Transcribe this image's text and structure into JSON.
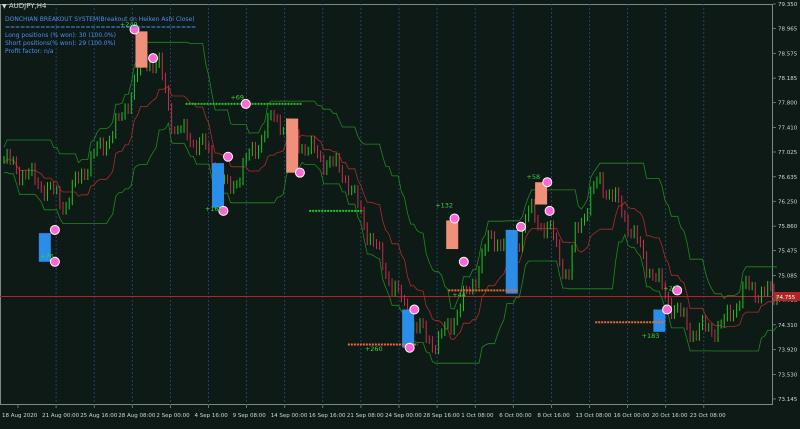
{
  "symbol_tab": "AUDJPY,H4",
  "info_panel": {
    "title": "DONCHIAN BREAKOUT SYSTEM(Breakout on Heiken Ashi Close)",
    "separator": "======================================",
    "long_positions": "Long positions (% won): 30 (100.0%)",
    "short_positions": "Short positions(% won): 29 (100.0%)",
    "profit_factor": "Profit factor: n/a"
  },
  "colors": {
    "background": "#0d1a16",
    "grid": "#2b4a7a",
    "bull_bar": "#21c521",
    "bear_bar": "#c5304a",
    "channel": "#1f8a1f",
    "midline": "#b02a2a",
    "price_line": "#b02424",
    "long_box": "#2a8de8",
    "short_box": "#f0907a",
    "profit_label": "#3fcf3f",
    "signal_marker": "#ff66d6"
  },
  "chart_data": {
    "type": "candlestick",
    "y_axis": {
      "min": 73.05,
      "max": 79.35,
      "ticks": [
        "79.350",
        "78.965",
        "78.575",
        "78.185",
        "77.800",
        "77.410",
        "77.025",
        "76.635",
        "76.250",
        "75.860",
        "75.475",
        "75.085",
        "74.700",
        "74.310",
        "73.920",
        "73.530",
        "73.145"
      ],
      "current_price": "74.755"
    },
    "x_axis": {
      "ticks": [
        "18 Aug 2020",
        "21 Aug 00:00",
        "25 Aug 16:00",
        "28 Aug 08:00",
        "2 Sep 00:00",
        "4 Sep 16:00",
        "9 Sep 08:00",
        "14 Sep 00:00",
        "16 Sep 16:00",
        "21 Sep 08:00",
        "24 Sep 00:00",
        "28 Sep 16:00",
        "1 Oct 08:00",
        "6 Oct 00:00",
        "8 Oct 16:00",
        "13 Oct 08:00",
        "16 Oct 00:00",
        "20 Oct 16:00",
        "23 Oct 08:00"
      ]
    },
    "series": [
      {
        "name": "AUDJPY H4 Heiken Ashi",
        "waypoints": [
          [
            0,
            76.9
          ],
          [
            0.05,
            76.5
          ],
          [
            0.08,
            76.2
          ],
          [
            0.1,
            76.7
          ],
          [
            0.15,
            77.5
          ],
          [
            0.18,
            78.5
          ],
          [
            0.2,
            78.4
          ],
          [
            0.22,
            77.4
          ],
          [
            0.26,
            77.1
          ],
          [
            0.29,
            76.4
          ],
          [
            0.32,
            77.0
          ],
          [
            0.35,
            77.6
          ],
          [
            0.39,
            77.1
          ],
          [
            0.44,
            76.7
          ],
          [
            0.47,
            75.8
          ],
          [
            0.5,
            75.0
          ],
          [
            0.53,
            74.3
          ],
          [
            0.56,
            74.0
          ],
          [
            0.6,
            74.8
          ],
          [
            0.63,
            75.7
          ],
          [
            0.66,
            75.5
          ],
          [
            0.68,
            76.1
          ],
          [
            0.71,
            75.7
          ],
          [
            0.73,
            75.0
          ],
          [
            0.74,
            75.8
          ],
          [
            0.77,
            76.6
          ],
          [
            0.8,
            76.1
          ],
          [
            0.83,
            75.3
          ],
          [
            0.86,
            74.7
          ],
          [
            0.89,
            74.2
          ],
          [
            0.93,
            74.3
          ],
          [
            0.96,
            74.9
          ],
          [
            1.0,
            74.75
          ]
        ]
      }
    ],
    "trade_labels": [
      "+249",
      "+76",
      "+69",
      "+168",
      "+260",
      "+132",
      "+44",
      "+58",
      "+27",
      "+183"
    ]
  }
}
